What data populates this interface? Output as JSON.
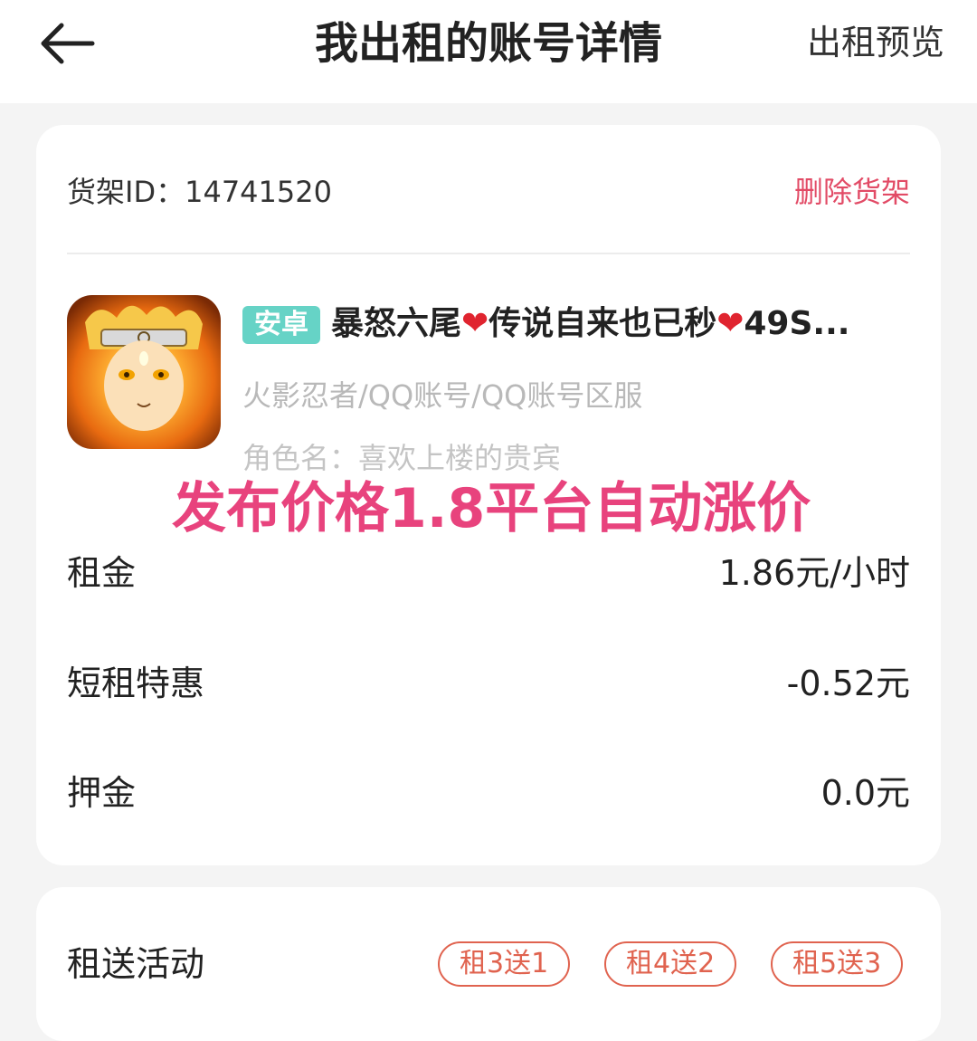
{
  "header": {
    "title": "我出租的账号详情",
    "action_label": "出租预览"
  },
  "shelf": {
    "id_label": "货架ID：",
    "id_value": "14741520",
    "delete_label": "删除货架"
  },
  "listing": {
    "platform_badge": "安卓",
    "title_part1": "暴怒六尾",
    "title_part2": "传说自来也已秒",
    "title_part3": "49S...",
    "heart_glyph": "❤",
    "category": "火影忍者/QQ账号/QQ账号区服",
    "role_name": "角色名：喜欢上楼的贵宾",
    "icon": "naruto-game-icon"
  },
  "overlay_note": "发布价格1.8平台自动涨价",
  "rows": [
    {
      "label": "租金",
      "value": "1.86元/小时"
    },
    {
      "label": "短租特惠",
      "value": "-0.52元"
    },
    {
      "label": "押金",
      "value": "0.0元"
    }
  ],
  "activity": {
    "label": "租送活动",
    "tags": [
      "租3送1",
      "租4送2",
      "租5送3"
    ]
  },
  "colors": {
    "accent_red": "#e24b66",
    "badge_teal": "#66d3c6",
    "overlay_pink": "#e8437d",
    "tag_orange": "#e0634f"
  }
}
